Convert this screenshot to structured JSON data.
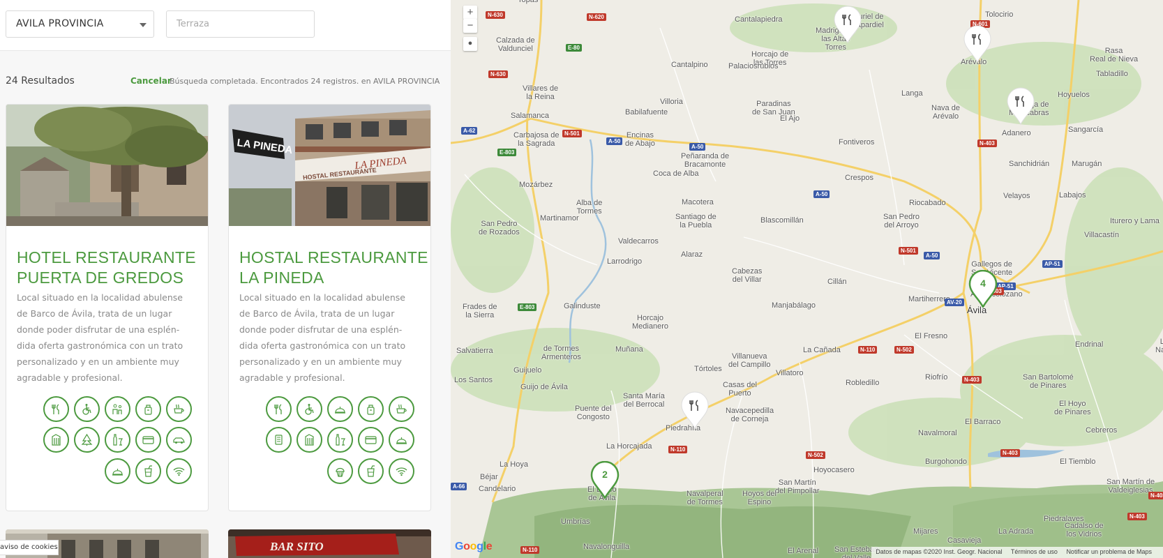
{
  "filters": {
    "province_value": "AVILA PROVINCIA",
    "search_placeholder": "Terraza"
  },
  "results": {
    "count_label": "24 Resultados",
    "cancel_label": "Cancelar",
    "message": "Búsqueda completada. Encontrados 24 registros. en AVILA PROVINCIA"
  },
  "cards": [
    {
      "title_lines": [
        "HOTEL RESTAURANTE",
        "PUERTA DE GREDOS"
      ],
      "desc_lines": [
        "Local situado en la localidad abulense",
        "de Barco de Ávila, trata de un lugar",
        "donde poder disfrutar de una esplén-",
        "dida oferta gastronómica con un trato",
        "personalizado y en un ambiente muy",
        "agradable y profesional."
      ],
      "amenity_icons": [
        "cutlery-icon",
        "wheelchair-icon",
        "family-icon",
        "baby-bottle-icon",
        "coffee-cup-icon",
        "building-icon",
        "tree-icon",
        "drinks-icon",
        "credit-card-icon",
        "car-icon",
        "dish-cover-icon",
        "juice-glass-icon",
        "wifi-icon"
      ]
    },
    {
      "title_lines": [
        "HOSTAL RESTAURANTE",
        "LA PINEDA"
      ],
      "desc_lines": [
        "Local situado en la localidad abulense",
        "de Barco de Ávila, trata de un lugar",
        "donde poder disfrutar de una esplén-",
        "dida oferta gastronómica con un trato",
        "personalizado y en un ambiente muy",
        "agradable y profesional."
      ],
      "amenity_icons": [
        "cutlery-icon",
        "wheelchair-icon",
        "dish-cover-icon",
        "baby-bottle-icon",
        "coffee-cup-icon",
        "menu-icon",
        "building-icon",
        "drinks-icon",
        "credit-card-icon",
        "dish-cover-icon",
        "cupcake-icon",
        "juice-glass-icon",
        "wifi-icon"
      ],
      "photo_sign_1": "LA PINEDA",
      "photo_sign_2": "HOSTAL RESTAURANTE",
      "photo_sign_3": "LA PINEDA"
    }
  ],
  "next_cards": {
    "bar_sign": "BAR SITO"
  },
  "cookie_notice": "aviso de cookies",
  "map": {
    "zoom_in": "+",
    "zoom_out": "−",
    "cluster_labels": [
      "4",
      "2"
    ],
    "town_labels": [
      "Topas",
      "Cantalapiedra",
      "Muriel de",
      "Zapardiel",
      "Tolocirio",
      "Calzada de",
      "Valdunciel",
      "Horcajo de",
      "las Torres",
      "Madrigal de",
      "las Altas",
      "Torres",
      "Arévalo",
      "Cantalpino",
      "Palaciosrubios",
      "Rasa",
      "Real de Nieva",
      "Tabladillo",
      "Villares de",
      "la Reina",
      "Villoria",
      "Paradinas",
      "de San Juan",
      "Langa",
      "Hoyuelos",
      "Nava de",
      "Arévalo",
      "Moraleja de",
      "Matacabras",
      "Salamanca",
      "Babilafuente",
      "El Ajo",
      "Adanero",
      "Sangarcía",
      "Carbajosa de",
      "la Sagrada",
      "Encinas",
      "de Abajo",
      "Fontiveros",
      "Sanchidrián",
      "Marugán",
      "Peñaranda de",
      "Bracamonte",
      "Coca de Alba",
      "Crespos",
      "Mozárbez",
      "Velayos",
      "Labajos",
      "Alba de",
      "Tormes",
      "Macotera",
      "Riocabado",
      "Martinamor",
      "Santiago de",
      "la Puebla",
      "Blascomillán",
      "San Pedro",
      "del Arroyo",
      "Iturero y Lama",
      "San Pedro",
      "de Rozados",
      "Villacastín",
      "Valdecarros",
      "Larrodrigo",
      "Alaraz",
      "Gallegos de",
      "San Vicente",
      "Cabezas",
      "del Villar",
      "Cillán",
      "Aldealcolozano",
      "Frades de",
      "la Sierra",
      "Galinduste",
      "Manjabálago",
      "Martiherrero",
      "Ávila",
      "Horcajo",
      "Medianero",
      "El Fresno",
      "Endrinal",
      "Salvatierra",
      "de Tormes",
      "Armenteros",
      "Muñana",
      "La Cañada",
      "Las",
      "Navas",
      "Villanueva",
      "del Campillo",
      "Tórtoles",
      "Villatoro",
      "Guijuelo",
      "Los Santos",
      "Robledillo",
      "Riofrío",
      "San Bartolomé",
      "de Pinares",
      "Guijo de Ávila",
      "Casas del",
      "Puerto",
      "Santa María",
      "del Berrocal",
      "Puente del",
      "Congosto",
      "Navacepedilla",
      "de Corneja",
      "El Hoyo",
      "de Pinares",
      "Piedrahíta",
      "El Barraco",
      "Cebreros",
      "La Horcajada",
      "Navalmoral",
      "La Hoya",
      "Burgohondo",
      "El Tiemblo",
      "Béjar",
      "Candelario",
      "El Barco",
      "de Ávila",
      "Hoyocasero",
      "San Martín",
      "del Pimpollar",
      "San Martín de",
      "Valdeiglesias",
      "Navalperal",
      "de Tormes",
      "Hoyos del",
      "Espino",
      "Piedralaves",
      "Umbrías",
      "La Adrada",
      "Mijares",
      "Casavieja",
      "Cadalso de",
      "los Vidrios",
      "Navalonguilla",
      "El Arenal",
      "San Esteban",
      "del Valle"
    ],
    "road_labels": [
      "N-630",
      "N-620",
      "N-601",
      "E-80",
      "N-630",
      "A-62",
      "N-501",
      "A-50",
      "A-50",
      "E-803",
      "N-403",
      "A-50",
      "N-501",
      "A-50",
      "AP-51",
      "AP-51",
      "N-403",
      "E-803",
      "AV-20",
      "N-110",
      "N-502",
      "N-403",
      "N-110",
      "N-502",
      "N-403",
      "A-66",
      "N-110",
      "N-403",
      "N-403"
    ],
    "google_logo": "Google",
    "attribution_data": "Datos de mapas ©2020 Inst. Geogr. Nacional",
    "attribution_terms": "Términos de uso",
    "attribution_report": "Notificar un problema de Maps"
  }
}
